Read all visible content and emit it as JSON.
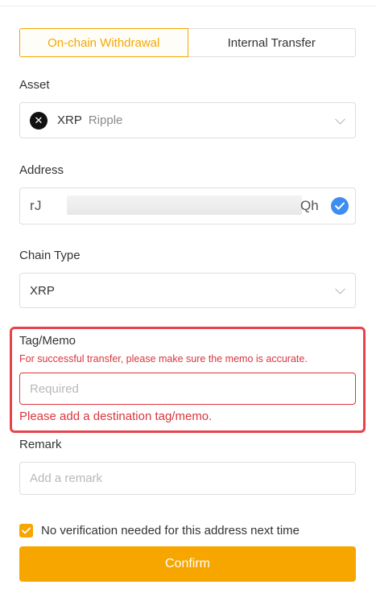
{
  "tabs": [
    {
      "label": "On-chain Withdrawal",
      "active": true
    },
    {
      "label": "Internal Transfer",
      "active": false
    }
  ],
  "asset": {
    "label": "Asset",
    "icon": "xrp-coin-icon",
    "symbol": "XRP",
    "name": "Ripple"
  },
  "address": {
    "label": "Address",
    "value_start": "rJ",
    "value_end": "Qh",
    "verified_icon": "check-circle-icon"
  },
  "chain_type": {
    "label": "Chain Type",
    "value": "XRP"
  },
  "memo": {
    "label": "Tag/Memo",
    "note": "For successful transfer, please make sure the memo is accurate.",
    "placeholder": "Required",
    "error": "Please add a destination tag/memo."
  },
  "remark": {
    "label": "Remark",
    "placeholder": "Add a remark"
  },
  "verification": {
    "label": "No verification needed for this address next time",
    "checked": true
  },
  "confirm_label": "Confirm",
  "colors": {
    "accent": "#f7a600",
    "error": "#e8434c",
    "verified": "#3d8ef0"
  }
}
